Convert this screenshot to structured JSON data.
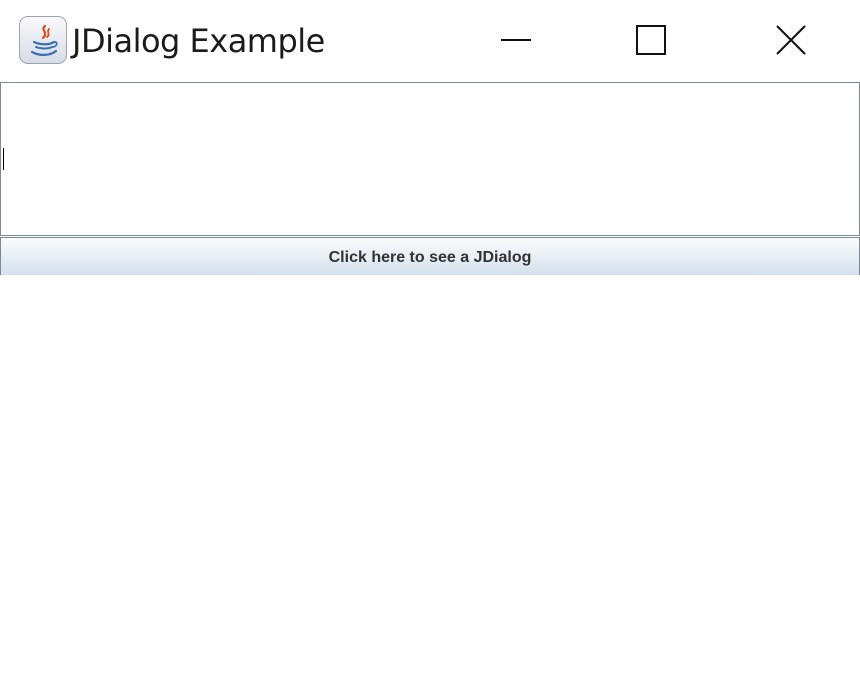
{
  "window": {
    "title": "JDialog Example",
    "app_icon": "java-icon"
  },
  "caption_buttons": {
    "minimize_icon": "minimize-icon",
    "maximize_icon": "maximize-icon",
    "close_icon": "close-icon"
  },
  "text_area": {
    "value": ""
  },
  "button": {
    "label": "Click here to see a JDialog"
  },
  "colors": {
    "button_gradient_top": "#fbfcfd",
    "button_gradient_bottom": "#d4e0ec",
    "border": "#7a8a99"
  }
}
